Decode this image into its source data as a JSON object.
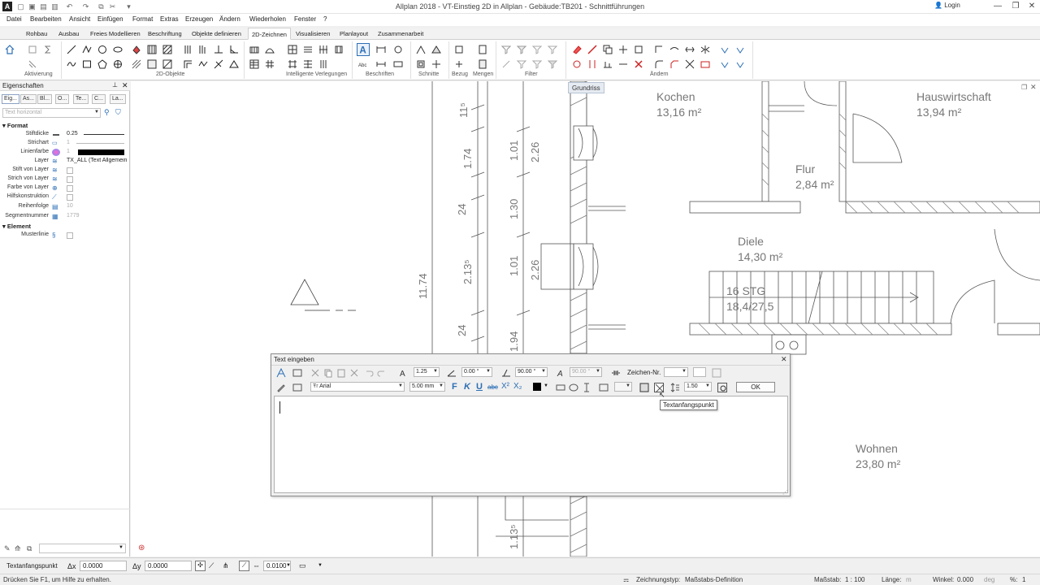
{
  "window": {
    "title": "Allplan 2018 - VT-Einstieg 2D in Allplan - Gebäude:TB201 - Schnittführungen",
    "login_label": "Login",
    "logo_letter": "A"
  },
  "menu": [
    "Datei",
    "Bearbeiten",
    "Ansicht",
    "Einfügen",
    "Format",
    "Extras",
    "Erzeugen",
    "Ändern",
    "Wiederholen",
    "Fenster",
    "?"
  ],
  "ribbon": {
    "tabs": [
      "Rohbau",
      "Ausbau",
      "Freies Modellieren",
      "Beschriftung",
      "Objekte definieren",
      "2D-Zeichnen",
      "Visualisieren",
      "Planlayout",
      "Zusammenarbeit"
    ],
    "active_tab": "2D-Zeichnen",
    "groups": [
      "Aktivierung",
      "2D-Objekte",
      "Intelligente Verlegungen",
      "Beschriften",
      "Schnitte",
      "Bezug",
      "Mengen",
      "Filter",
      "Ändern"
    ]
  },
  "properties": {
    "header": "Eigenschaften",
    "tabs": [
      "Eig...",
      "As...",
      "Bl...",
      "O...",
      "Te...",
      "C...",
      "La..."
    ],
    "search_placeholder": "Text horizontal",
    "section_format": "Format",
    "section_element": "Element",
    "rows": [
      {
        "label": "Stiftdicke",
        "value": "0.25"
      },
      {
        "label": "Strichart",
        "value": "1"
      },
      {
        "label": "Linienfarbe",
        "value": "1"
      },
      {
        "label": "Layer",
        "value": "TX_ALL (Text Allgemein)"
      },
      {
        "label": "Stift von Layer",
        "value": ""
      },
      {
        "label": "Strich von Layer",
        "value": ""
      },
      {
        "label": "Farbe von Layer",
        "value": ""
      },
      {
        "label": "Hilfskonstruktion",
        "value": ""
      },
      {
        "label": "Reihenfolge",
        "value": "10"
      },
      {
        "label": "Segmentnummer",
        "value": "1779"
      }
    ],
    "element_rows": [
      {
        "label": "Musterlinie",
        "value": ""
      }
    ]
  },
  "drawing": {
    "view_tab": "Grundriss",
    "rooms": [
      {
        "name": "Kochen",
        "area": "13,16 m²"
      },
      {
        "name": "Hauswirtschaft",
        "area": "13,94 m²"
      },
      {
        "name": "Flur",
        "area": "2,84 m²"
      },
      {
        "name": "Diele",
        "area": "14,30 m²"
      },
      {
        "name": "16 STG",
        "area": "18,4/27,5"
      },
      {
        "name": "Wohnen",
        "area": "23,80 m²"
      }
    ],
    "dimensions": [
      "11⁵",
      "1.74",
      "24",
      "2.13⁵",
      "24",
      "11.74",
      "1.01",
      "1.30",
      "1.01",
      "1.94",
      "2.26",
      "2.26",
      "1.13⁵"
    ]
  },
  "text_dialog": {
    "title": "Text eingeben",
    "height_value": "1.25",
    "angle_value": "0.00 °",
    "slant_value": "90.00 °",
    "slant2_value": "90.00 °",
    "char_no_label": "Zeichen-Nr.",
    "font_value": "Arial",
    "size_value": "5.00 mm",
    "spacing_value": "1.50",
    "ok_label": "OK",
    "text_value": ""
  },
  "tooltip": "Textanfangspunkt",
  "coords": {
    "mode_label": "Textanfangspunkt",
    "dx_label": "Δx",
    "dx_value": "0.0000",
    "dy_label": "Δy",
    "dy_value": "0.0000",
    "step_value": "0.0100"
  },
  "status": {
    "hint": "Drücken Sie F1, um Hilfe zu erhalten.",
    "drawing_type_label": "Zeichnungstyp:",
    "drawing_type_value": "Maßstabs-Definition",
    "scale_label": "Maßstab:",
    "scale_value": "1 : 100",
    "length_label": "Länge:",
    "length_unit": "m",
    "angle_label": "Winkel:",
    "angle_value": "0.000",
    "angle_unit": "deg",
    "percent_label": "%:",
    "percent_value": "1"
  }
}
